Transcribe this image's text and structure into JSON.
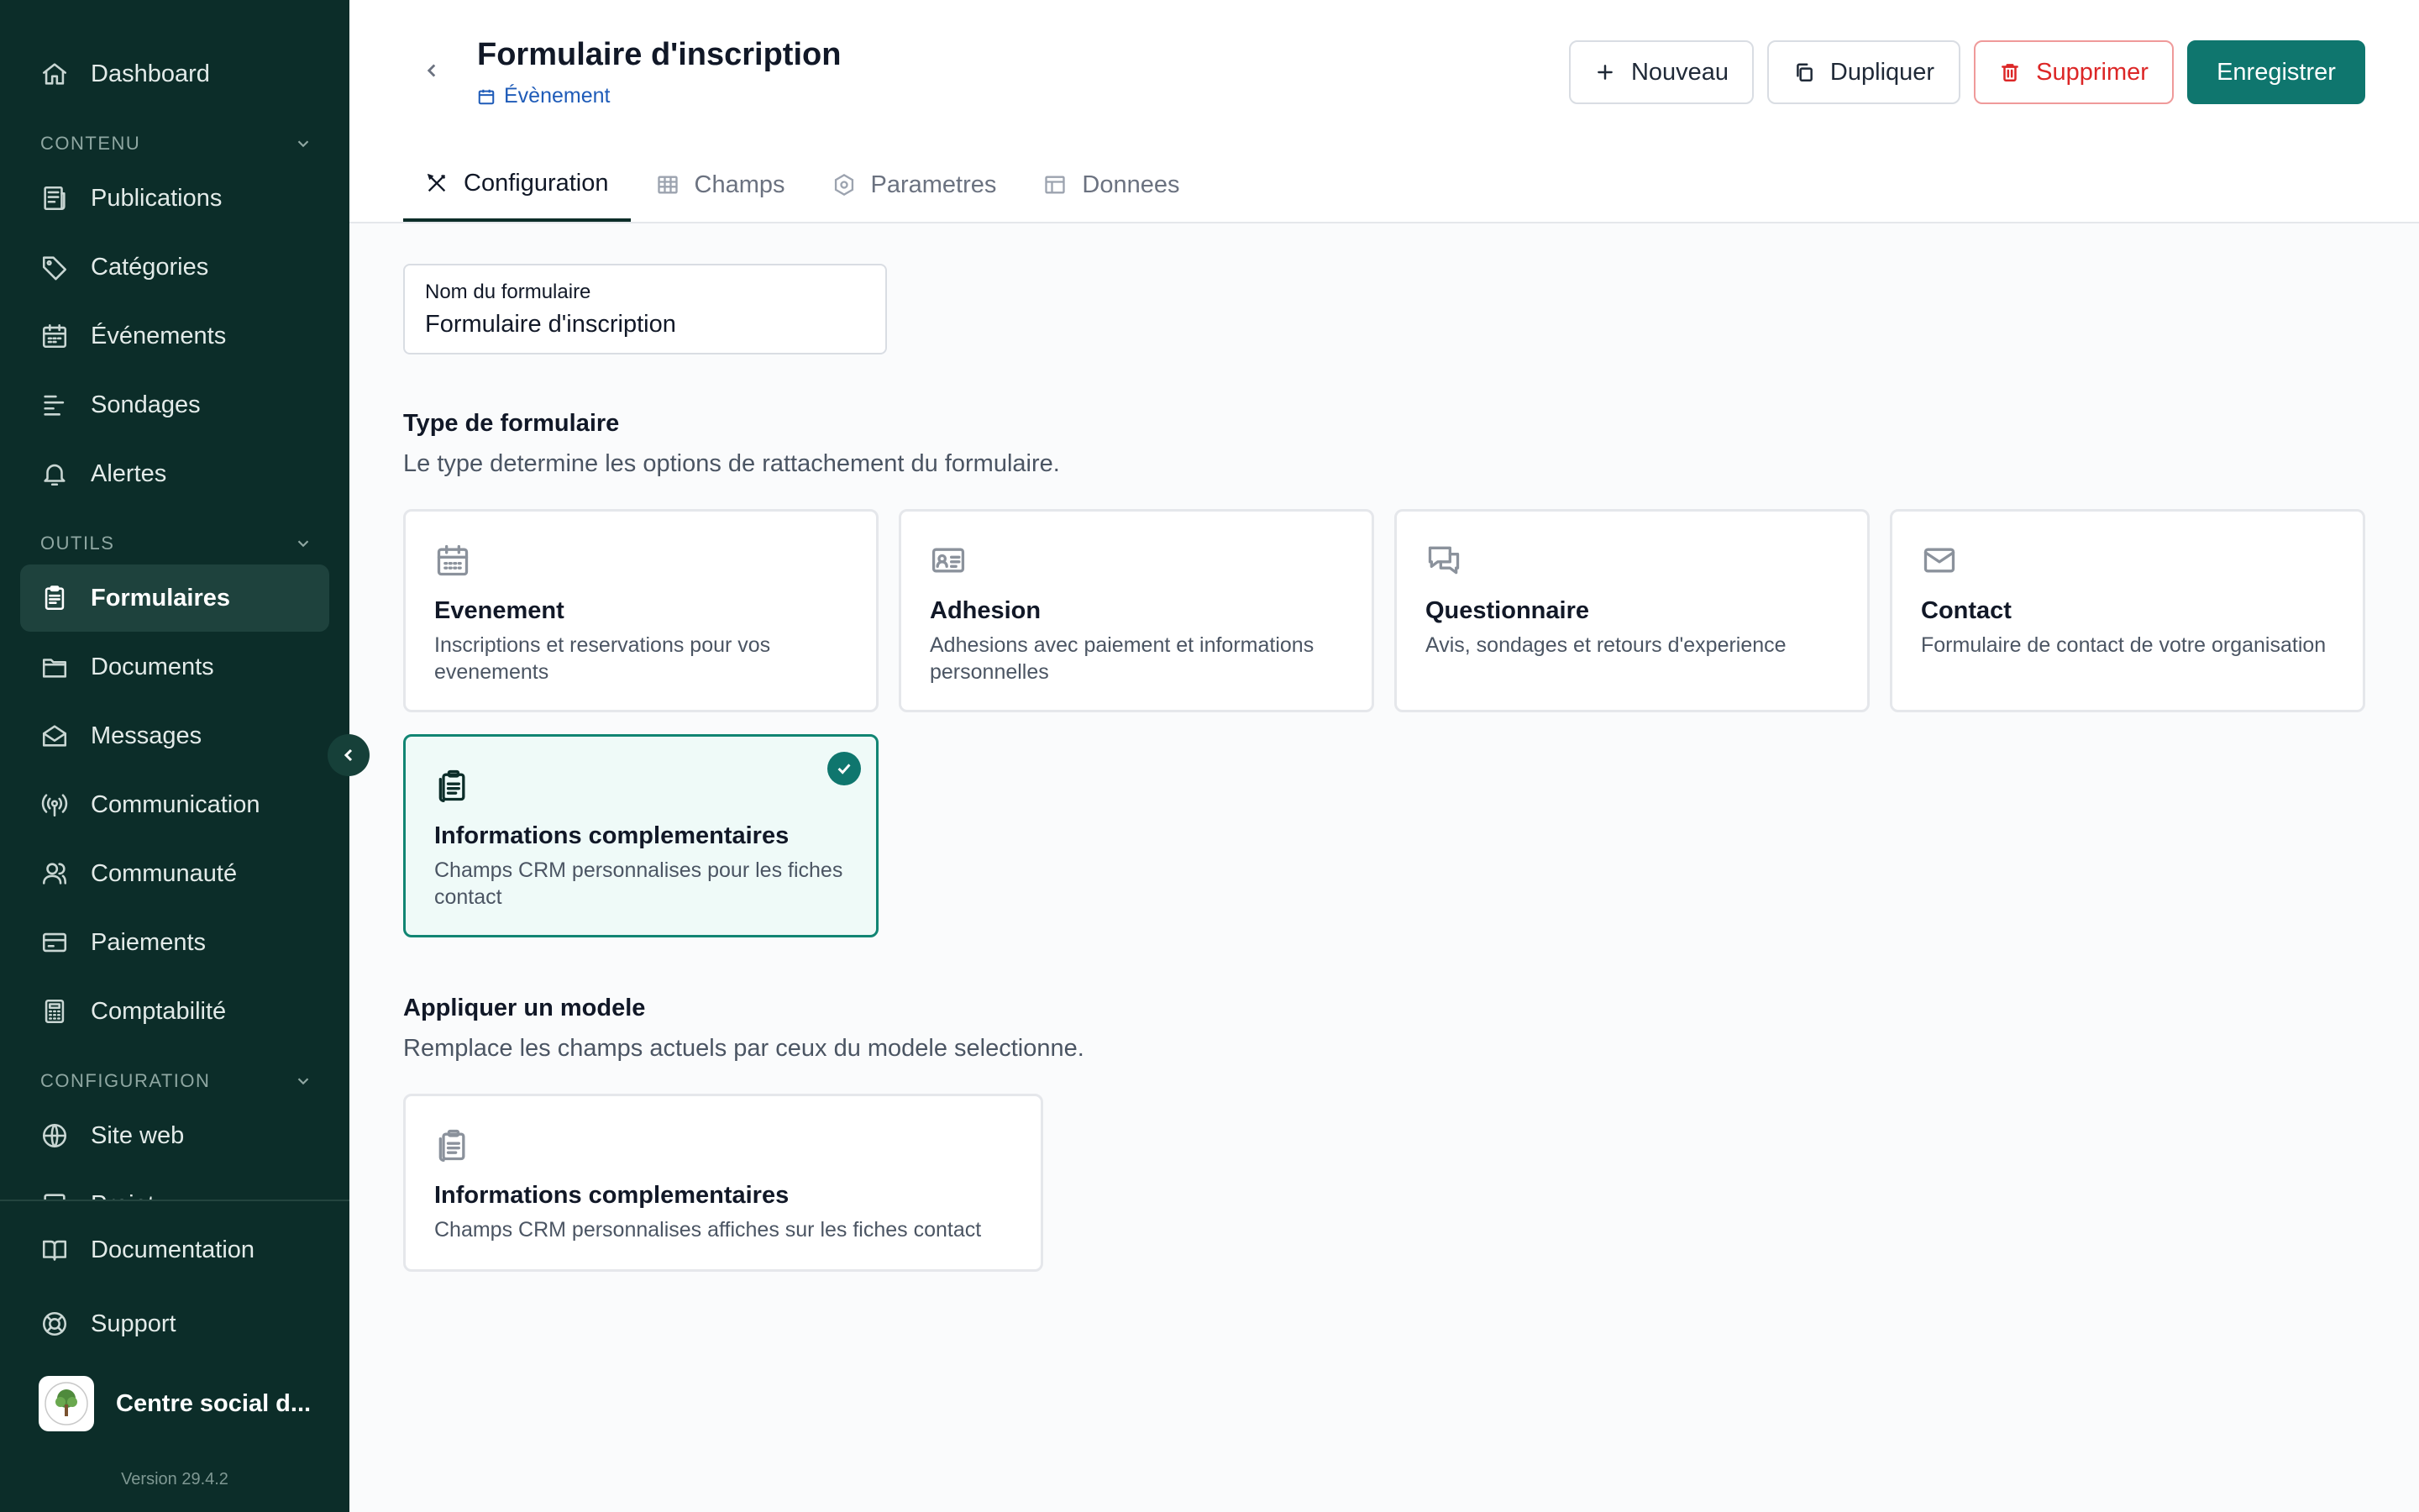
{
  "sidebar": {
    "dashboard": "Dashboard",
    "sections": {
      "content": "CONTENU",
      "tools": "OUTILS",
      "configuration": "CONFIGURATION"
    },
    "items": {
      "publications": "Publications",
      "categories": "Catégories",
      "events": "Événements",
      "polls": "Sondages",
      "alerts": "Alertes",
      "forms": "Formulaires",
      "documents": "Documents",
      "messages": "Messages",
      "communication": "Communication",
      "community": "Communauté",
      "payments": "Paiements",
      "accounting": "Comptabilité",
      "website": "Site web",
      "project": "Projet"
    },
    "documentation": "Documentation",
    "support": "Support",
    "org_name": "Centre social d...",
    "version": "Version 29.4.2"
  },
  "header": {
    "title": "Formulaire d'inscription",
    "subtitle": "Évènement",
    "buttons": {
      "new": "Nouveau",
      "duplicate": "Dupliquer",
      "delete": "Supprimer",
      "save": "Enregistrer"
    }
  },
  "tabs": {
    "configuration": "Configuration",
    "fields": "Champs",
    "settings": "Parametres",
    "data": "Donnees",
    "active": "configuration"
  },
  "form": {
    "name_label": "Nom du formulaire",
    "name_value": "Formulaire d'inscription"
  },
  "form_type": {
    "title": "Type de formulaire",
    "description": "Le type determine les options de rattachement du formulaire.",
    "selected": "info",
    "options": {
      "event": {
        "title": "Evenement",
        "desc": "Inscriptions et reservations pour vos evenements",
        "icon": "calendar-icon"
      },
      "membership": {
        "title": "Adhesion",
        "desc": "Adhesions avec paiement et informations personnelles",
        "icon": "id-card-icon"
      },
      "survey": {
        "title": "Questionnaire",
        "desc": "Avis, sondages et retours d'experience",
        "icon": "chat-icon"
      },
      "contact": {
        "title": "Contact",
        "desc": "Formulaire de contact de votre organisation",
        "icon": "mail-icon"
      },
      "info": {
        "title": "Informations complementaires",
        "desc": "Champs CRM personnalises pour les fiches contact",
        "icon": "clipboard-icon"
      }
    }
  },
  "template": {
    "title": "Appliquer un modele",
    "description": "Remplace les champs actuels par ceux du modele selectionne.",
    "card": {
      "title": "Informations complementaires",
      "desc": "Champs CRM personnalises affiches sur les fiches contact",
      "icon": "clipboard-icon"
    }
  },
  "colors": {
    "sidebar_bg": "#0c2d29",
    "primary": "#0f766e",
    "danger": "#dc2626",
    "link": "#1e5bb8"
  }
}
